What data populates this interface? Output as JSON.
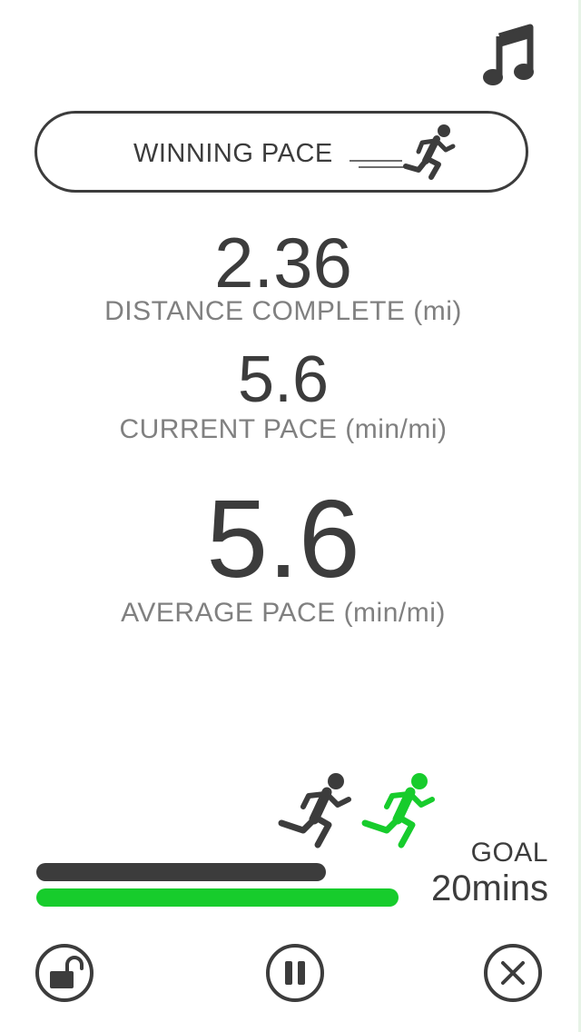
{
  "header": {
    "music_icon": "music-note-icon"
  },
  "pace_mode": {
    "label": "WINNING PACE",
    "icon": "running-person-icon"
  },
  "stats": {
    "distance": {
      "value": "2.36",
      "label": "DISTANCE COMPLETE (mi)"
    },
    "current_pace": {
      "value": "5.6",
      "label": "CURRENT PACE (min/mi)"
    },
    "average_pace": {
      "value": "5.6",
      "label": "AVERAGE PACE (min/mi)"
    }
  },
  "progress": {
    "you_fraction": 0.52,
    "target_fraction": 0.65,
    "you_color": "#3c3c3c",
    "target_color": "#17cc2c",
    "goal_label": "GOAL",
    "goal_value": "20mins"
  },
  "controls": {
    "lock_icon": "unlock-icon",
    "pause_icon": "pause-icon",
    "close_icon": "close-icon"
  },
  "colors": {
    "text_dark": "#3c3c3c",
    "text_gray": "#808080",
    "accent_green": "#17cc2c"
  }
}
